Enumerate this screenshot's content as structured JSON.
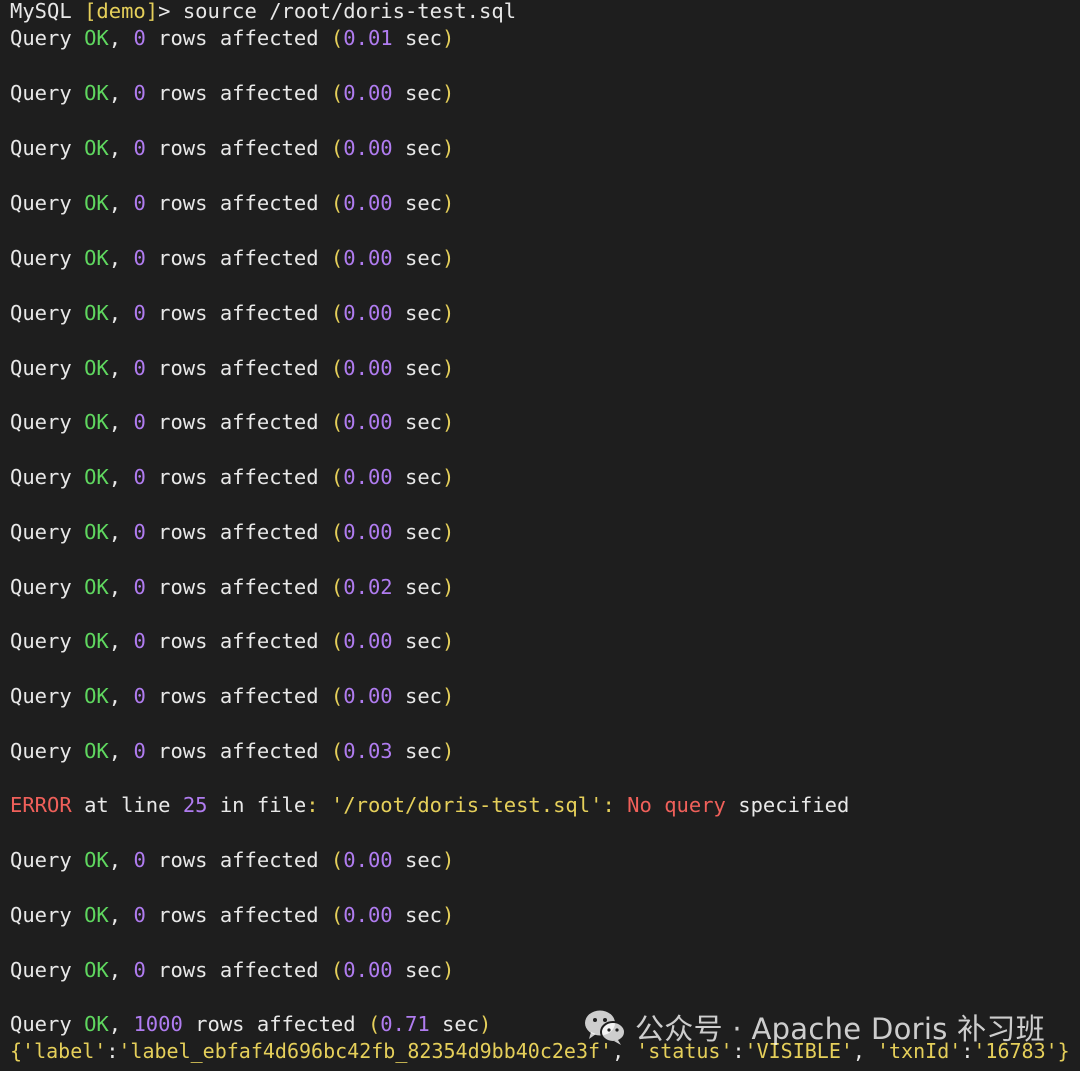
{
  "prompt": {
    "mysql": "MySQL",
    "db": "[demo]",
    "gt": ">",
    "command": "source /root/doris-test.sql"
  },
  "query_ok": {
    "word": "Query",
    "ok": "OK",
    "comma": ",",
    "rows_affected": "rows affected",
    "open_paren": "(",
    "sec": "sec",
    "close_paren": ")"
  },
  "results": [
    {
      "rows": "0",
      "time": "0.01"
    },
    {
      "rows": "0",
      "time": "0.00"
    },
    {
      "rows": "0",
      "time": "0.00"
    },
    {
      "rows": "0",
      "time": "0.00"
    },
    {
      "rows": "0",
      "time": "0.00"
    },
    {
      "rows": "0",
      "time": "0.00"
    },
    {
      "rows": "0",
      "time": "0.00"
    },
    {
      "rows": "0",
      "time": "0.00"
    },
    {
      "rows": "0",
      "time": "0.00"
    },
    {
      "rows": "0",
      "time": "0.00"
    },
    {
      "rows": "0",
      "time": "0.02"
    },
    {
      "rows": "0",
      "time": "0.00"
    },
    {
      "rows": "0",
      "time": "0.00"
    },
    {
      "rows": "0",
      "time": "0.03"
    },
    {
      "rows": "0",
      "time": "0.00"
    },
    {
      "rows": "0",
      "time": "0.00"
    },
    {
      "rows": "0",
      "time": "0.00"
    },
    {
      "rows": "1000",
      "time": "0.71"
    }
  ],
  "error": {
    "label": "ERROR",
    "at_line": "at line",
    "line_no": "25",
    "in_file": "in file",
    "colon": ":",
    "file": "'/root/doris-test.sql'",
    "colon2": ":",
    "no": "No",
    "query": "query",
    "specified": "specified"
  },
  "load_result": {
    "open": "{",
    "label_key": "'label'",
    "label_val": "'label_ebfaf4d696bc42fb_82354d9bb40c2e3f'",
    "status_key": "'status'",
    "status_val": "'VISIBLE'",
    "txn_key": "'txnId'",
    "txn_val": "'16783'",
    "close": "}"
  },
  "watermark": {
    "text": "公众号 · Apache Doris 补习班",
    "icon": "wechat-icon"
  },
  "colors": {
    "background": "#1e1e1e",
    "text": "#e8e8e8",
    "ok": "#5fd75f",
    "number": "#b07cf0",
    "string": "#e5cf5a",
    "error": "#f0605a"
  }
}
